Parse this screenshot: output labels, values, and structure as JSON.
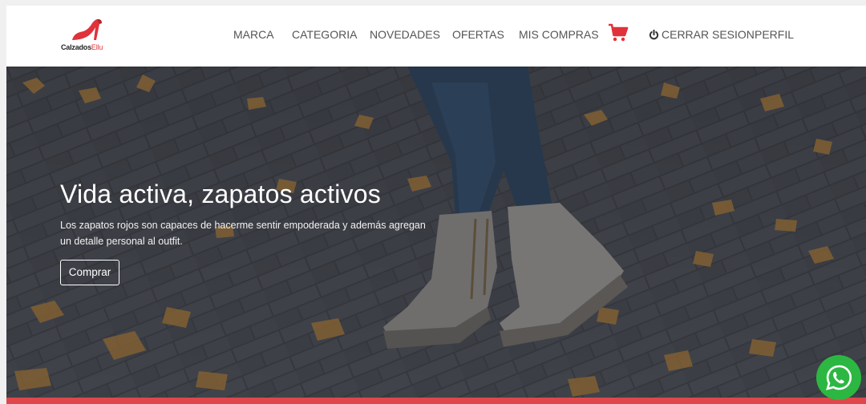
{
  "brand": {
    "logo_dark": "Calzados",
    "logo_accent": "Ellu",
    "accent_color": "#e0323b"
  },
  "nav": {
    "items": [
      "MARCA",
      "CATEGORIA",
      "NOVEDADES",
      "OFERTAS",
      "MIS COMPRAS"
    ],
    "cart_icon": "shopping-cart-icon",
    "logout_label": "CERRAR SESION",
    "profile_label": "PERFIL"
  },
  "hero": {
    "title": "Vida activa, zapatos activos",
    "text": "Los zapatos rojos son capaces de hacerme sentir empoderada y además agregan un detalle personal al outfit.",
    "button_label": "Comprar"
  },
  "whatsapp": {
    "icon": "whatsapp-icon",
    "color": "#2cb742"
  }
}
